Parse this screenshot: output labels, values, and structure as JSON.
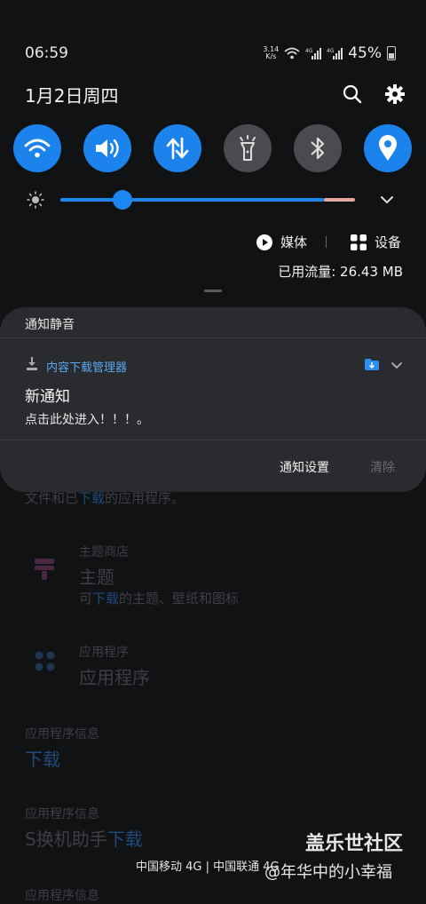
{
  "status_bar": {
    "time": "06:59",
    "net_speed_value": "3.14",
    "net_speed_unit": "K/s",
    "battery": "45%"
  },
  "header": {
    "date": "1月2日周四",
    "search_icon": "search-icon",
    "settings_icon": "gear-icon"
  },
  "quick_toggles": [
    {
      "name": "wifi",
      "icon": "wifi-icon",
      "on": true
    },
    {
      "name": "sound",
      "icon": "volume-icon",
      "on": true
    },
    {
      "name": "mobile-data",
      "icon": "data-arrows-icon",
      "on": true
    },
    {
      "name": "flashlight",
      "icon": "flashlight-icon",
      "on": false
    },
    {
      "name": "bluetooth",
      "icon": "bluetooth-icon",
      "on": false
    },
    {
      "name": "location",
      "icon": "location-pin-icon",
      "on": true
    }
  ],
  "brightness": {
    "level": 0.21
  },
  "media_label": "媒体",
  "devices_label": "设备",
  "data_usage": "已用流量: 26.43 MB",
  "notification": {
    "section_title": "通知静音",
    "app_name": "内容下载管理器",
    "title": "新通知",
    "body": "点击此处进入！！！。",
    "settings_button": "通知设置",
    "clear_button": "清除"
  },
  "background_list": {
    "partial_text_a": "文件和已",
    "partial_text_link": "下载",
    "partial_text_b": "的应用程序。",
    "theme_category": "主题商店",
    "theme_title": "主题",
    "theme_desc_a": "可",
    "theme_desc_link": "下载",
    "theme_desc_b": "的主题、壁纸和图标",
    "apps_category": "应用程序",
    "apps_title": "应用程序",
    "info1_category": "应用程序信息",
    "info1_title": "下载",
    "info2_category": "应用程序信息",
    "info2_title_a": "S换机助手",
    "info2_title_link": "下载",
    "info3_category": "应用程序信息"
  },
  "carrier_text": "中国移动 4G | 中国联通 4G",
  "watermark": {
    "line1": "盖乐世社区",
    "line2": "@年华中的小幸福"
  },
  "colors": {
    "accent": "#1c82ec",
    "toggle_off": "#4a4b4e",
    "card": "#2a2b2e",
    "background": "#111214"
  }
}
